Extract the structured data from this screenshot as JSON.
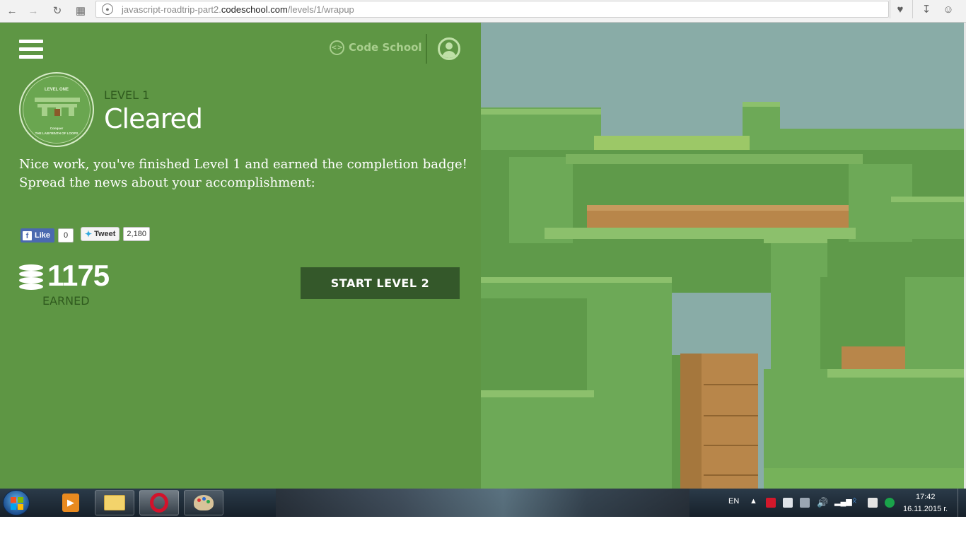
{
  "browser": {
    "url_prefix": "javascript-roadtrip-part2.",
    "url_domain": "codeschool.com",
    "url_path": "/levels/1/wrapup"
  },
  "header": {
    "brand": "Code School",
    "brand_icon": "code-brackets-icon"
  },
  "badge": {
    "top_text": "LEVEL ONE",
    "sub_text_1": "Conquer",
    "sub_text_2": "THE LABYRINTH OF LOOPS"
  },
  "level": {
    "label": "LEVEL 1",
    "status": "Cleared",
    "message_line1": "Nice work, you've finished Level 1 and earned the completion badge!",
    "message_line2": "Spread the news about your accomplishment:"
  },
  "social": {
    "like_label": "Like",
    "like_count": "0",
    "tweet_label": "Tweet",
    "tweet_count": "2,180"
  },
  "score": {
    "points": "1175",
    "earned_label": "EARNED"
  },
  "actions": {
    "start_label": "START LEVEL 2"
  },
  "taskbar": {
    "lang": "EN",
    "time": "17:42",
    "date": "16.11.2015 г."
  },
  "colors": {
    "panel_green": "#5e9644",
    "dark_green": "#34582a",
    "sky": "#89aca7",
    "hedge": "#6da957",
    "dirt": "#b8864a"
  }
}
